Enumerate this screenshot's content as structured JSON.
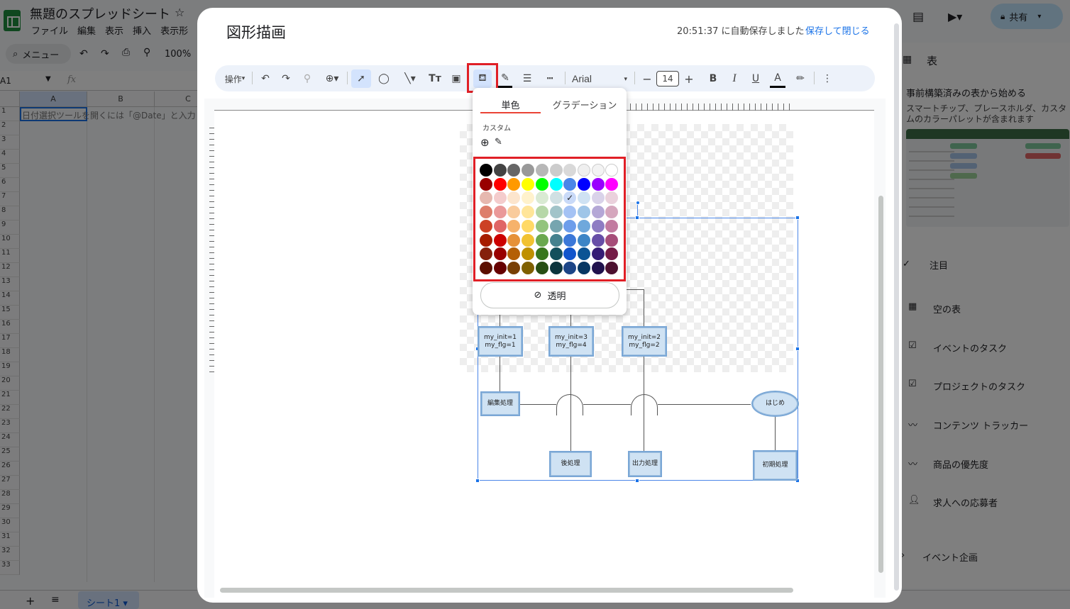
{
  "sheets_app": {
    "doc_title": "無題のスプレッドシート",
    "menu": [
      "ファイル",
      "編集",
      "表示",
      "挿入",
      "表示形"
    ],
    "menu_search": "メニュー",
    "zoom": "100%",
    "name_box": "A1",
    "fx": "fx",
    "share_label": "共有",
    "columns": [
      "A",
      "B",
      "C"
    ],
    "rows": [
      "1",
      "2",
      "3",
      "4",
      "5",
      "6",
      "7",
      "8",
      "9",
      "10",
      "11",
      "12",
      "13",
      "14",
      "15",
      "16",
      "17",
      "18",
      "19",
      "20",
      "21",
      "22",
      "23",
      "24",
      "25",
      "26",
      "27",
      "28",
      "29",
      "30",
      "31",
      "32",
      "33"
    ],
    "cell_a1_text": "日付選択ツールを開くには「@Date」と入力",
    "sheet_tab": "シート1"
  },
  "right_panel": {
    "title": "表",
    "heading": "事前構築済みの表から始める",
    "desc": "スマートチップ、プレースホルダ、カスタムのカラーパレットが含まれます",
    "section_featured": "注目",
    "items": [
      "空の表",
      "イベントのタスク",
      "プロジェクトのタスク",
      "コンテンツ トラッカー",
      "商品の優先度",
      "求人への応募者",
      "イベント企画"
    ]
  },
  "dialog": {
    "title": "図形描画",
    "autosave": "20:51:37 に自動保存しました",
    "save_close": "保存して閉じる",
    "toolbar": {
      "actions": "操作",
      "font": "Arial",
      "font_size": "14"
    }
  },
  "fill_popup": {
    "tab_solid": "単色",
    "tab_gradient": "グラデーション",
    "custom_label": "カスタム",
    "transparent_label": "透明",
    "selected_color": "#c9daf8",
    "palette_rows": [
      [
        "#000000",
        "#434343",
        "#666666",
        "#999999",
        "#b7b7b7",
        "#cccccc",
        "#d9d9d9",
        "#efefef",
        "#f3f3f3",
        "#ffffff"
      ],
      [
        "#980000",
        "#ff0000",
        "#ff9900",
        "#ffff00",
        "#00ff00",
        "#00ffff",
        "#4a86e8",
        "#0000ff",
        "#9900ff",
        "#ff00ff"
      ],
      [
        "#e6b8af",
        "#f4cccc",
        "#fce5cd",
        "#fff2cc",
        "#d9ead3",
        "#d0e0e3",
        "#c9daf8",
        "#cfe2f3",
        "#d9d2e9",
        "#ead1dc"
      ],
      [
        "#dd7e6b",
        "#ea9999",
        "#f9cb9c",
        "#ffe599",
        "#b6d7a8",
        "#a2c4c9",
        "#a4c2f4",
        "#9fc5e8",
        "#b4a7d6",
        "#d5a6bd"
      ],
      [
        "#cc4125",
        "#e06666",
        "#f6b26b",
        "#ffd966",
        "#93c47d",
        "#76a5af",
        "#6d9eeb",
        "#6fa8dc",
        "#8e7cc3",
        "#c27ba0"
      ],
      [
        "#a61c00",
        "#cc0000",
        "#e69138",
        "#f1c232",
        "#6aa84f",
        "#45818e",
        "#3c78d8",
        "#3d85c6",
        "#674ea7",
        "#a64d79"
      ],
      [
        "#85200c",
        "#990000",
        "#b45f06",
        "#bf9000",
        "#38761d",
        "#134f5c",
        "#1155cc",
        "#0b5394",
        "#351c75",
        "#741b47"
      ],
      [
        "#5b0f00",
        "#660000",
        "#783f04",
        "#7f6000",
        "#274e13",
        "#0c343d",
        "#1c4587",
        "#073763",
        "#20124d",
        "#4c1130"
      ]
    ]
  },
  "flowchart": {
    "box1": [
      "my_init=1",
      "my_flg=1"
    ],
    "box2": [
      "my_init=3",
      "my_flg=4"
    ],
    "box3": [
      "my_init=2",
      "my_flg=2"
    ],
    "edit": "編集処理",
    "start": "はじめ",
    "post": "後処理",
    "output": "出力処理",
    "init": "初期処理"
  }
}
